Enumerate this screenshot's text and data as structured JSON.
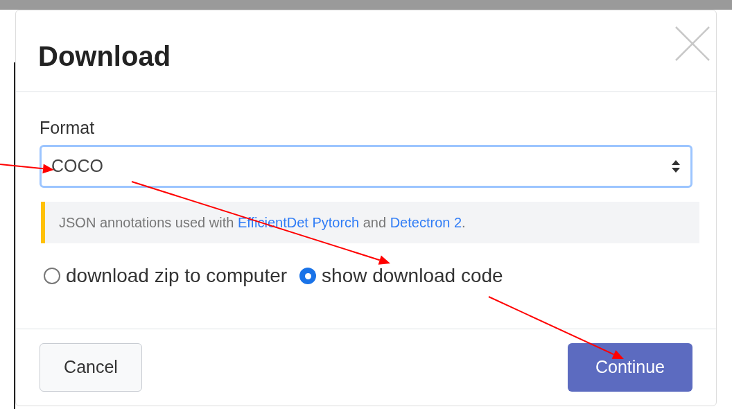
{
  "dialog": {
    "title": "Download",
    "format": {
      "label": "Format",
      "value": "COCO"
    },
    "help": [
      {
        "kind": "text",
        "text": "JSON annotations used with "
      },
      {
        "kind": "link",
        "text": "EfficientDet Pytorch"
      },
      {
        "kind": "text",
        "text": " and "
      },
      {
        "kind": "link",
        "text": "Detectron 2"
      },
      {
        "kind": "text",
        "text": "."
      }
    ],
    "options": [
      {
        "label": "download zip to computer",
        "selected": false
      },
      {
        "label": "show download code",
        "selected": true
      }
    ],
    "buttons": [
      {
        "label": "Cancel",
        "kind": "secondary"
      },
      {
        "label": "Continue",
        "kind": "primary"
      }
    ]
  }
}
